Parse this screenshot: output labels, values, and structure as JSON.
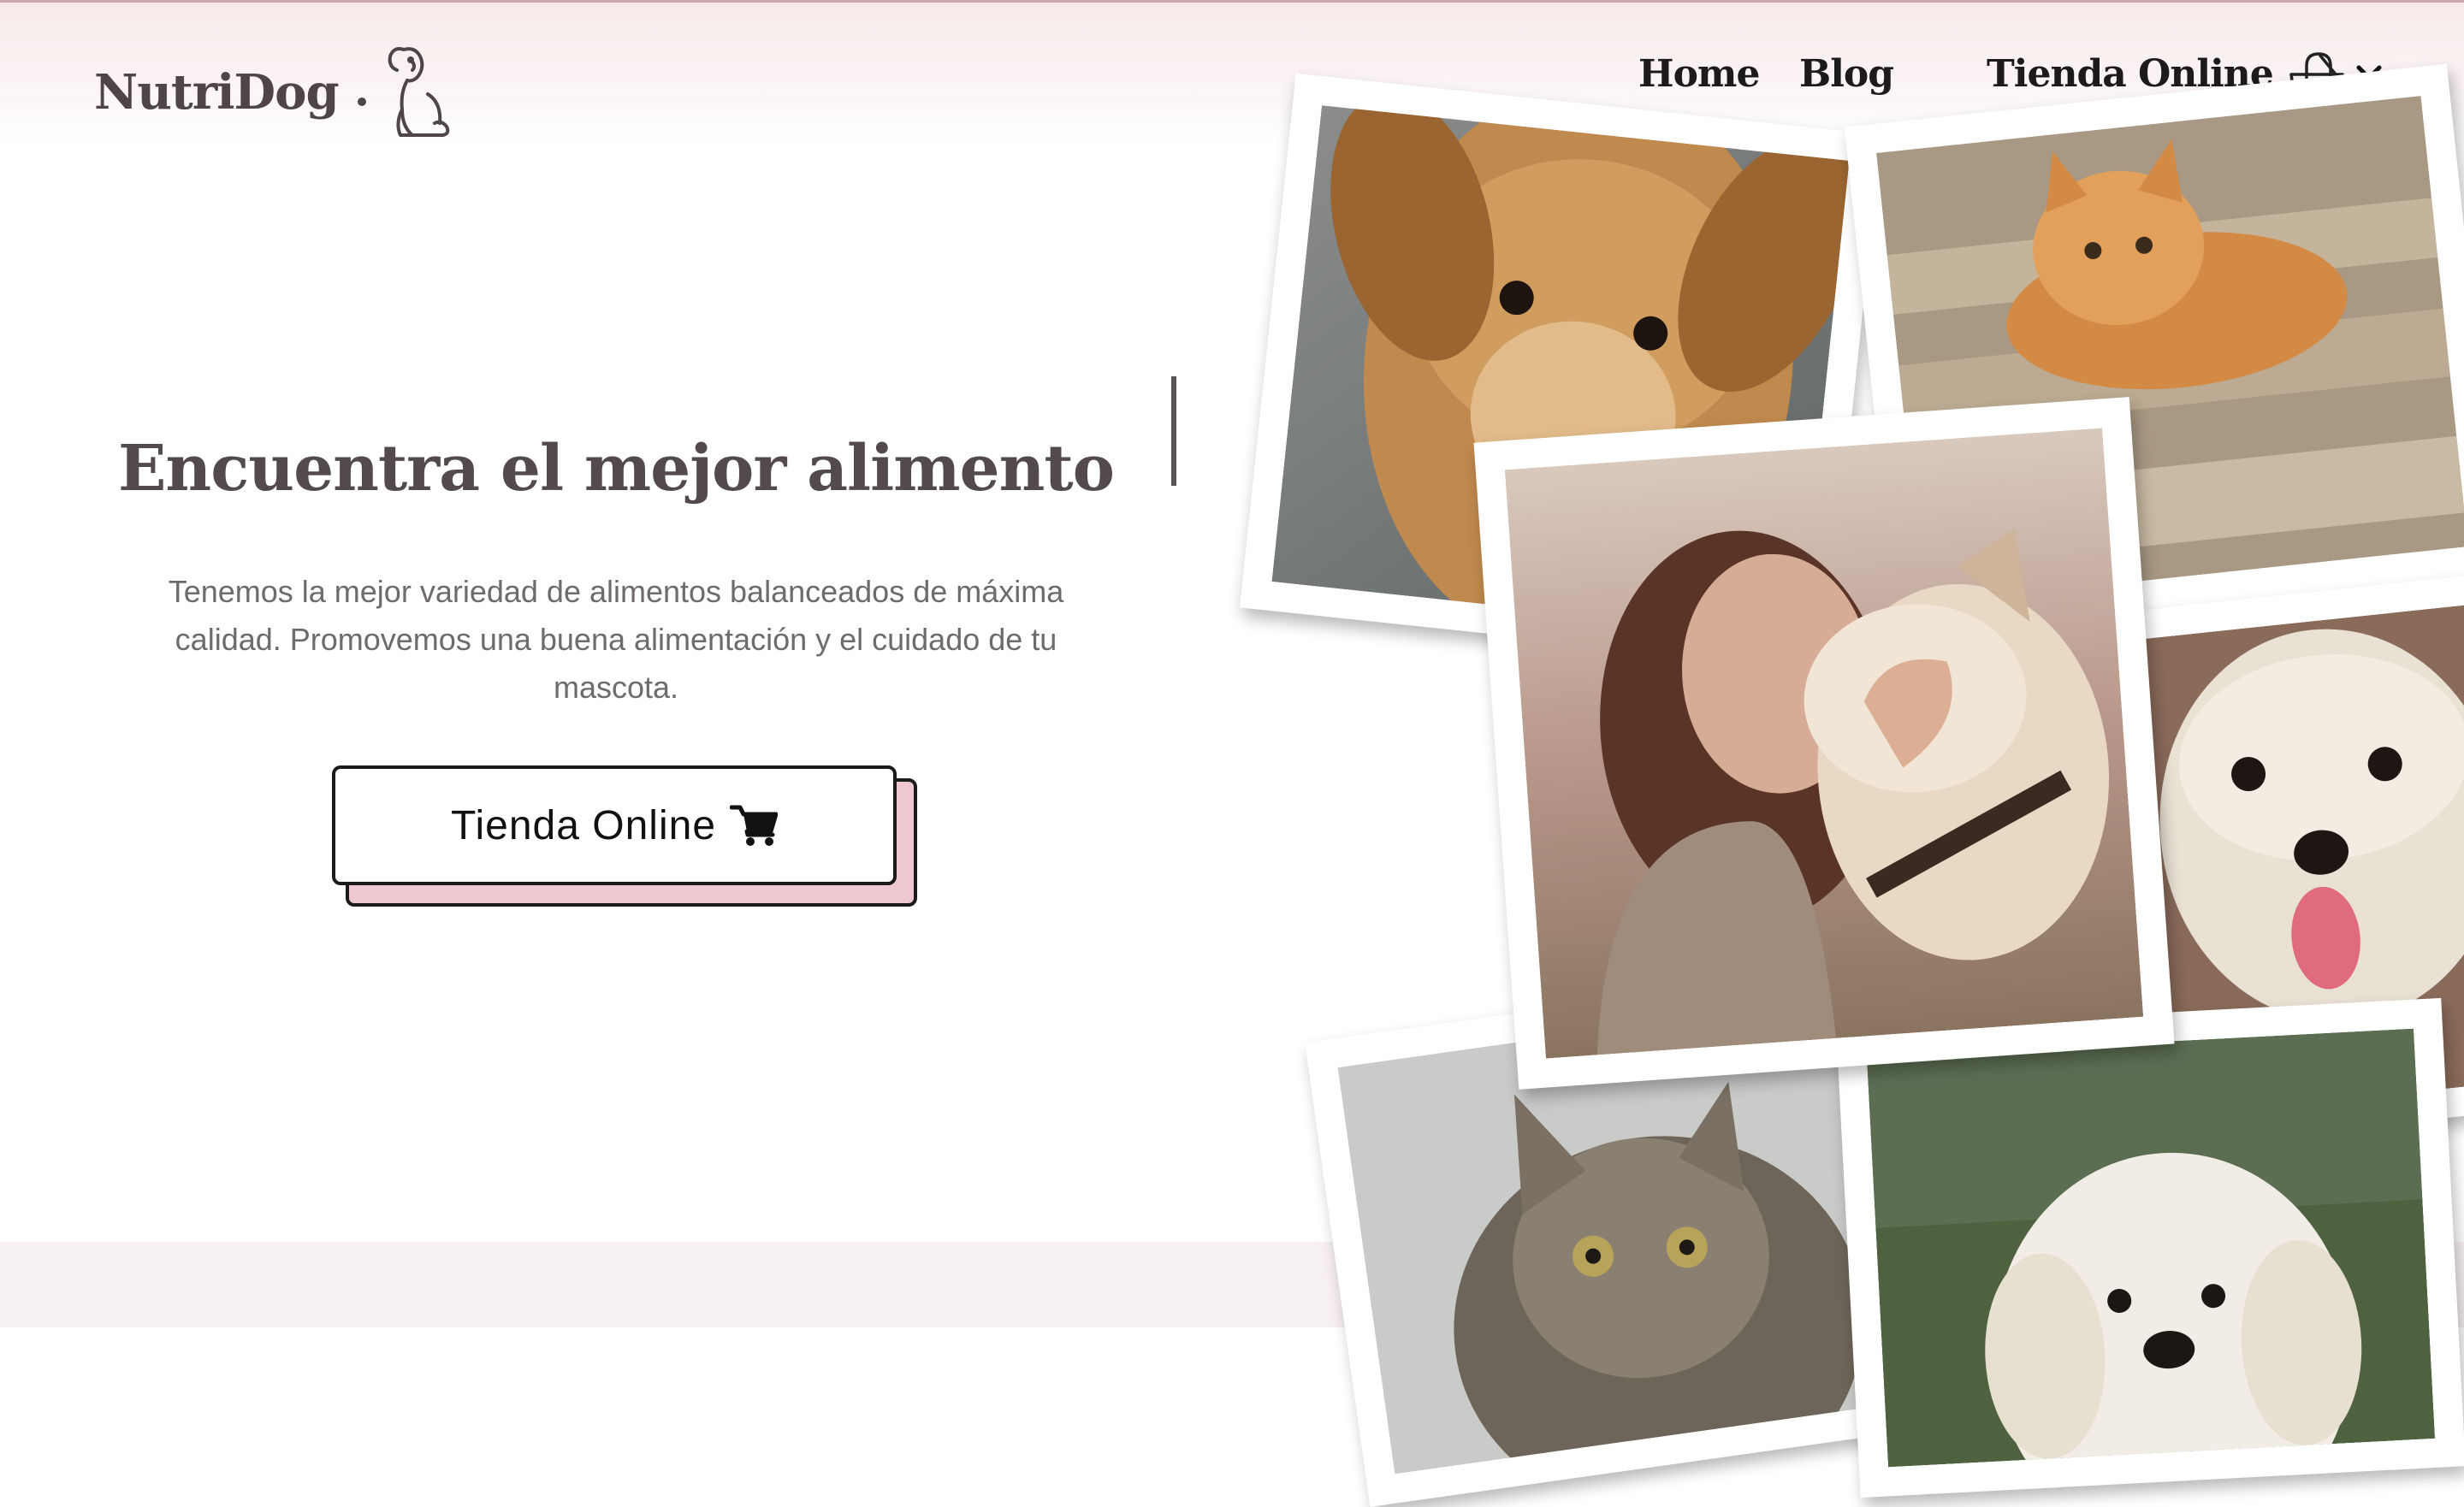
{
  "brand": {
    "name": "NutriDog",
    "logo_icon": "sitting-dog-icon"
  },
  "nav": {
    "items": [
      {
        "label": "Home"
      },
      {
        "label": "Blog"
      },
      {
        "label": "Tienda Online"
      }
    ],
    "cart_icon": "shopping-bag-heart-icon",
    "dropdown_icon": "chevron-down-icon"
  },
  "hero": {
    "title": "Encuentra el mejor alimento",
    "description": "Tenemos la mejor variedad de alimentos balanceados de máxima calidad. Promovemos una buena alimentación y el cuidado de tu mascota.",
    "cta_label": "Tienda Online",
    "cta_icon": "shopping-cart-icon"
  },
  "gallery": {
    "photos": [
      {
        "name": "photo-golden-puppy"
      },
      {
        "name": "photo-orange-kitten"
      },
      {
        "name": "photo-woman-with-dog"
      },
      {
        "name": "photo-curly-white-dog"
      },
      {
        "name": "photo-tabby-cat"
      },
      {
        "name": "photo-white-retriever-puppy"
      }
    ]
  },
  "colors": {
    "accent_pink": "#efc7d0",
    "header_tint": "#f6e9ea",
    "text_dark": "#4a4446"
  }
}
